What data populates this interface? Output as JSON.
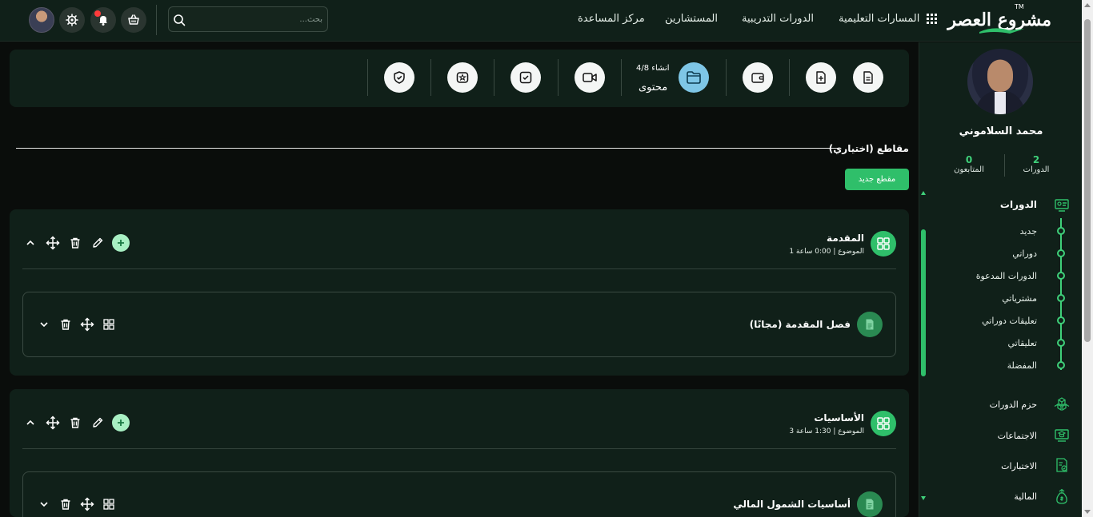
{
  "header": {
    "logo_text": "مشروع العصر",
    "logo_tm": "TM",
    "nav": {
      "learning_paths": "المسارات التعليمية",
      "training_courses": "الدورات التدريبية",
      "consultants": "المستشارين",
      "help_center": "مركز المساعدة"
    },
    "search_placeholder": "بحث..."
  },
  "sidebar": {
    "profile_name": "محمد السلاموني",
    "stats": {
      "courses_num": "2",
      "courses_label": "الدورات",
      "followers_num": "0",
      "followers_label": "المتابعون"
    },
    "courses_section": "الدورات",
    "course_items": [
      "جديد",
      "دوراتي",
      "الدورات المدعوة",
      "مشترياتي",
      "تعليقات دوراتي",
      "تعليقاتي",
      "المفضلة"
    ],
    "bundles": "حزم الدورات",
    "meetings": "الاجتماعات",
    "quizzes": "الاختبارات",
    "finance": "المالية"
  },
  "toolbar": {
    "count": "انشاء 4/8",
    "label": "محتوى"
  },
  "clips": {
    "title": "مقاطع (اختياري)",
    "new_button": "مقطع جديد"
  },
  "sections": [
    {
      "title": "المقدمة",
      "meta": "1 الموضوع | 0:00 ساعة",
      "lesson_title": "فصل المقدمة (مجانًا)"
    },
    {
      "title": "الأساسيات",
      "meta": "3 الموضوع | 1:30 ساعة",
      "lesson_title": "أساسيات الشمول المالي"
    }
  ],
  "colors": {
    "accent": "#2fbf6a",
    "background": "#0a0d0b",
    "card": "#102019",
    "active_tool": "#7ec6e6"
  }
}
